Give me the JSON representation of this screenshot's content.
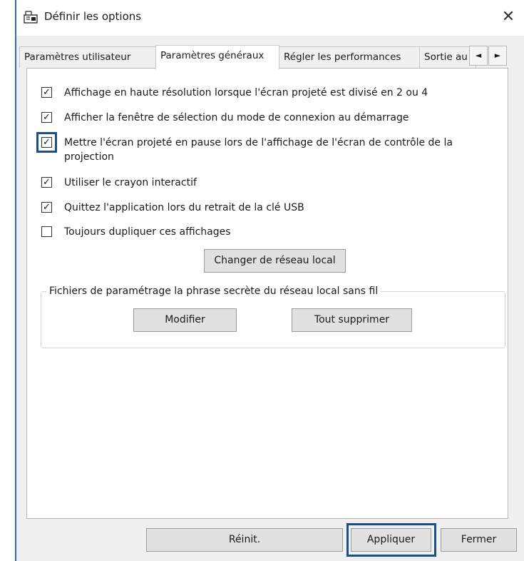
{
  "window": {
    "title": "Définir les options"
  },
  "tabs": [
    {
      "label": "Paramètres utilisateur"
    },
    {
      "label": "Paramètres généraux"
    },
    {
      "label": "Régler les performances"
    },
    {
      "label": "Sortie au"
    }
  ],
  "tab_scroll": {
    "left": "◄",
    "right": "►"
  },
  "options": [
    {
      "label": "Affichage en haute résolution lorsque l'écran projeté est divisé en 2 ou 4",
      "checked": true
    },
    {
      "label": "Afficher la fenêtre de sélection du mode de connexion au démarrage",
      "checked": true
    },
    {
      "label": "Mettre l'écran projeté en pause lors de l'affichage de l'écran de contrôle de la projection",
      "checked": true,
      "highlighted": true
    },
    {
      "label": "Utiliser le crayon interactif",
      "checked": true
    },
    {
      "label": "Quittez l'application lors du retrait de la clé USB",
      "checked": true
    },
    {
      "label": "Toujours dupliquer ces affichages",
      "checked": false
    }
  ],
  "network_button": "Changer de réseau local",
  "passphrase_group": {
    "title": "Fichiers de paramétrage la phrase secrète du réseau local sans fil",
    "modify": "Modifier",
    "delete_all": "Tout supprimer"
  },
  "footer": {
    "reset": "Réinit.",
    "apply": "Appliquer",
    "close": "Fermer"
  },
  "check_glyph": "✓",
  "colors": {
    "highlight": "#1f4e8c"
  }
}
